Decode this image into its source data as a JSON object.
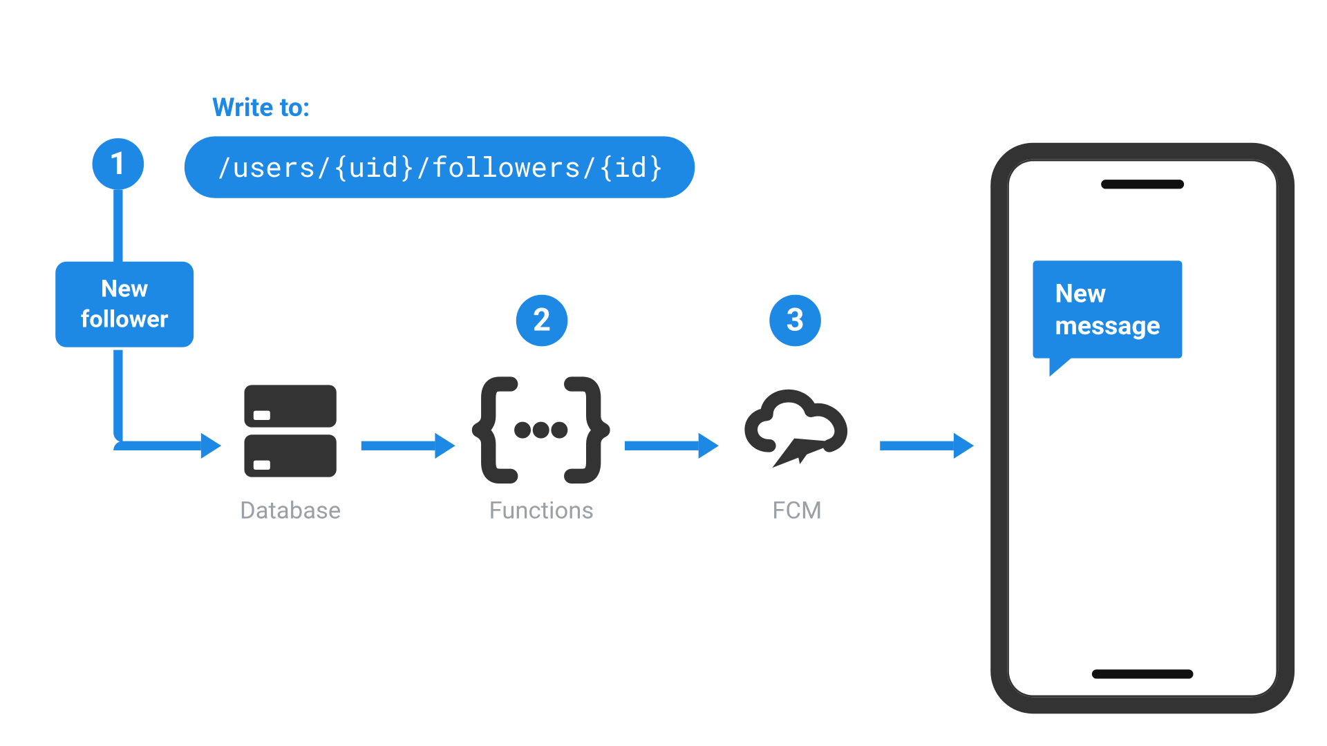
{
  "header": {
    "write_label": "Write to:",
    "path": "/users/{uid}/followers/{id}"
  },
  "steps": {
    "s1": "1",
    "s2": "2",
    "s3": "3"
  },
  "trigger_box": {
    "line1": "New",
    "line2": "follower"
  },
  "services": {
    "database": "Database",
    "functions": "Functions",
    "fcm": "FCM"
  },
  "phone": {
    "bubble_line1": "New",
    "bubble_line2": "message"
  },
  "colors": {
    "accent": "#1E88E5",
    "icon": "#333333",
    "muted": "#9AA0A6"
  }
}
